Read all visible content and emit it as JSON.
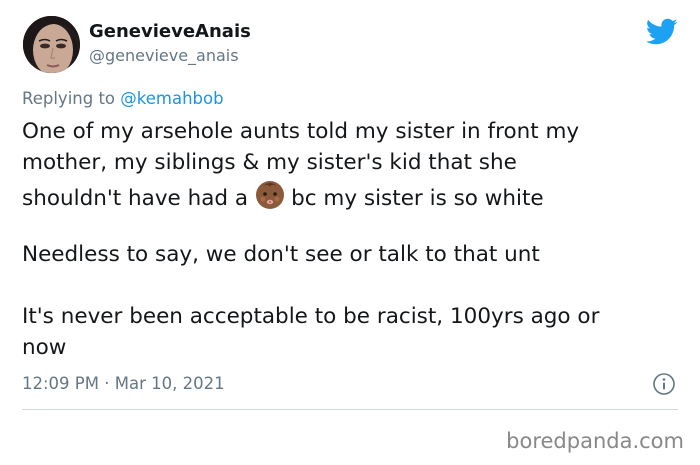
{
  "tweet": {
    "author": {
      "display_name": "GenevieveAnais",
      "handle": "@genevieve_anais"
    },
    "replying_prefix": "Replying to ",
    "replying_to": "@kemahbob",
    "text_lines": [
      "One of my arsehole aunts told my sister in front my",
      "mother, my siblings & my sister's kid that she",
      "shouldn't have had a",
      "bc my sister is so white",
      "Needless to say, we don't see or talk to that unt",
      "It's never been acceptable to be racist, 100yrs ago or",
      "now"
    ],
    "emoji": "baby-emoji-medium-dark-skin",
    "time": "12:09 PM",
    "separator": "·",
    "date": "Mar 10, 2021"
  },
  "icons": {
    "platform": "twitter-bird-icon",
    "info": "info-icon"
  },
  "colors": {
    "brand_blue": "#1da1f2",
    "mention_blue": "#1b95e0",
    "muted_gray": "#657786",
    "text": "#14171a"
  },
  "watermark": "boredpanda.com"
}
